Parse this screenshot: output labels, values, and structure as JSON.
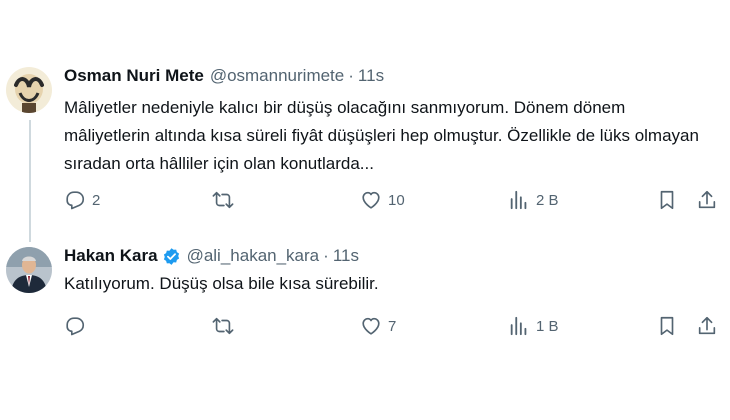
{
  "tweets": [
    {
      "name": "Osman Nuri Mete",
      "handle": "@osmannurimete",
      "separator": "·",
      "time": "11s",
      "verified": false,
      "text": "Mâliyetler nedeniyle kalıcı bir düşüş olacağını sanmıyorum. Dönem dönem mâliyetlerin altında kısa süreli fiyât düşüşleri hep olmuştur. Özellikle de lüks olmayan sıradan orta hâlliler için olan konutlarda...",
      "replies": "2",
      "retweets": "",
      "likes": "10",
      "views": "2 B"
    },
    {
      "name": "Hakan Kara",
      "handle": "@ali_hakan_kara",
      "separator": "·",
      "time": "11s",
      "verified": true,
      "text": "Katılıyorum. Düşüş olsa bile kısa sürebilir.",
      "replies": "",
      "retweets": "",
      "likes": "7",
      "views": "1 B"
    }
  ],
  "colors": {
    "text": "#0f1419",
    "muted": "#536471",
    "verified": "#1d9bf0",
    "thread_line": "#cfd9de"
  },
  "icons": [
    "reply-icon",
    "retweet-icon",
    "like-icon",
    "views-icon",
    "bookmark-icon",
    "share-icon",
    "verified-badge-icon"
  ]
}
